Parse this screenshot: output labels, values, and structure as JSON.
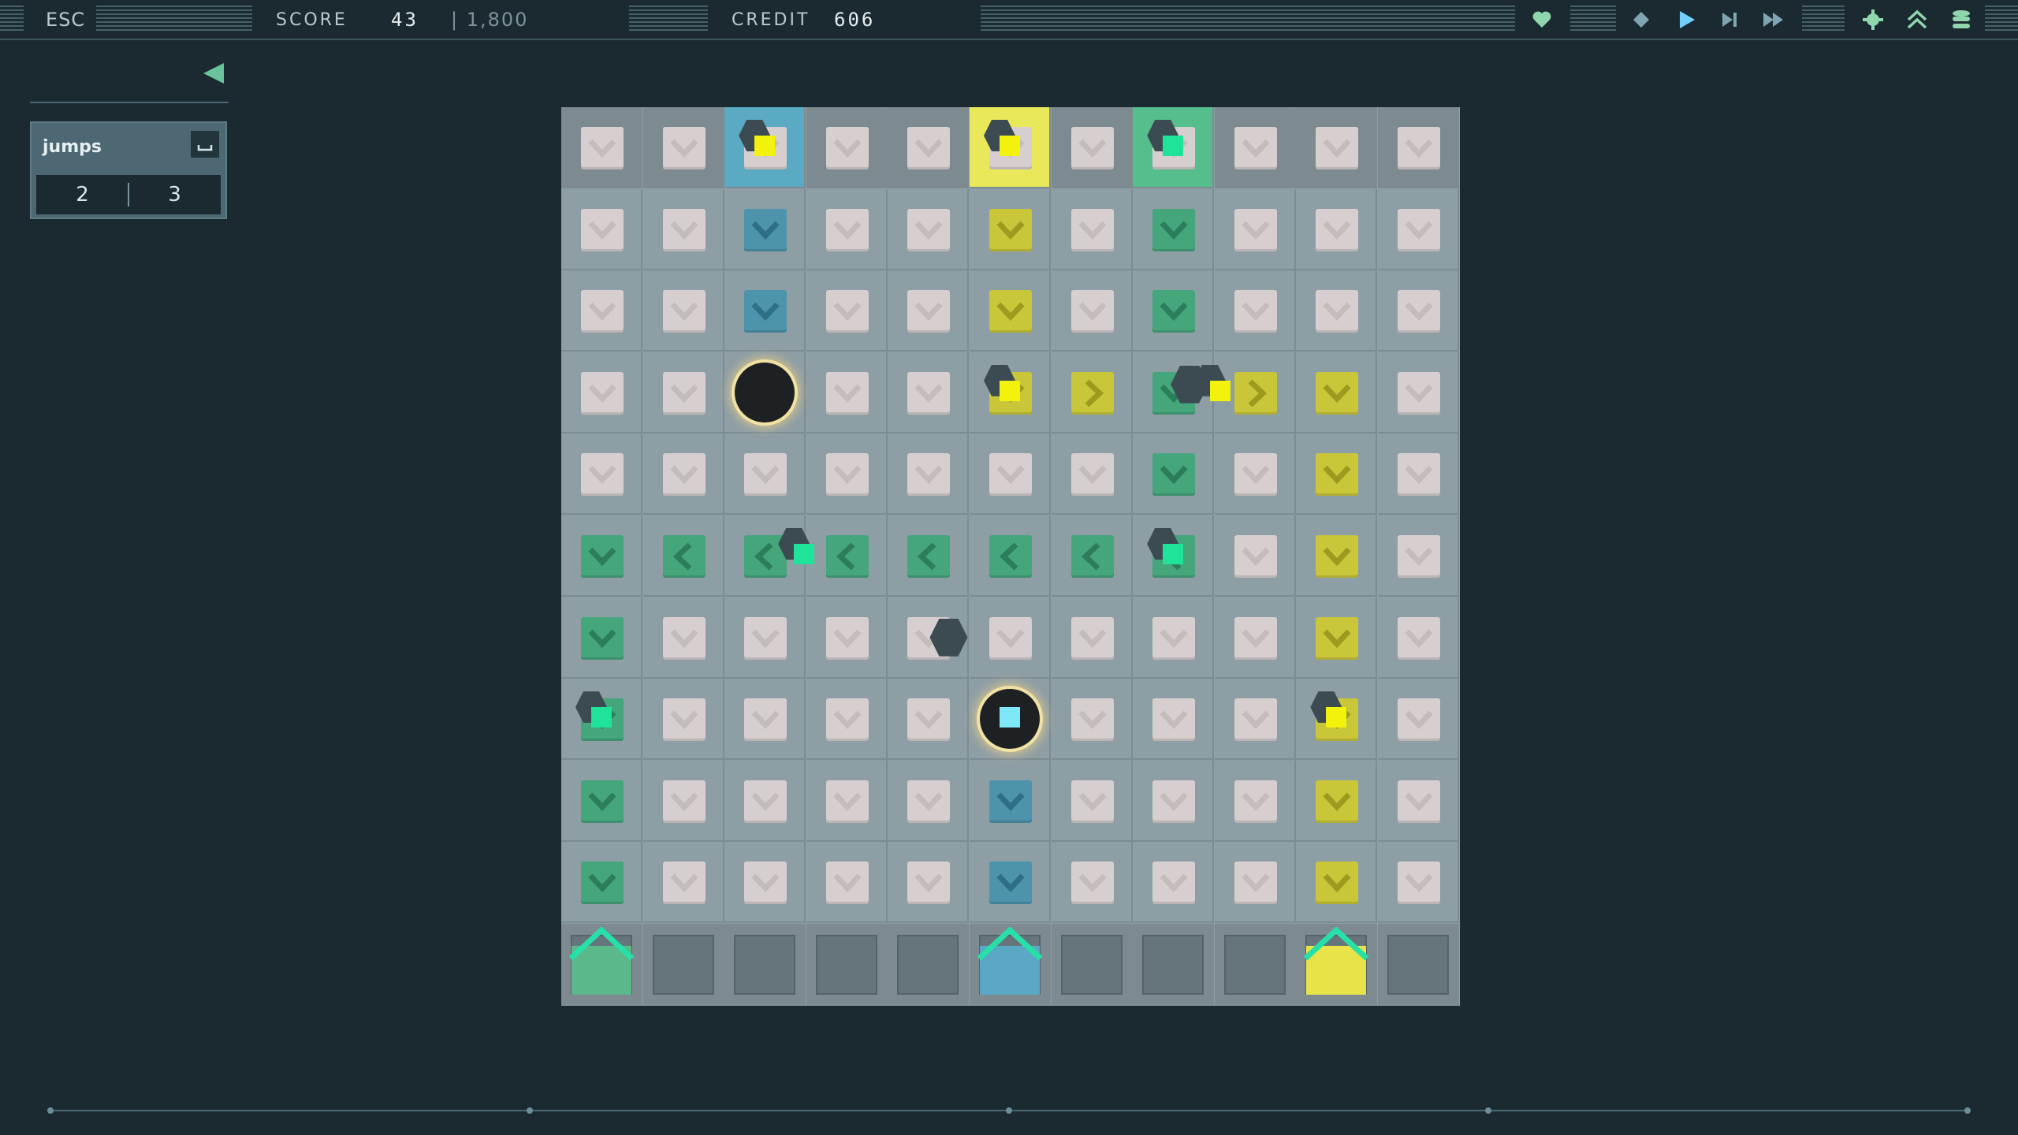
{
  "topbar": {
    "esc_label": "ESC",
    "score_label": "SCORE",
    "score_value": "43",
    "score_target": "| 1,800",
    "credit_label": "CREDIT",
    "credit_value": "606",
    "icons": [
      "heart-icon",
      "diamond-icon",
      "play-icon",
      "step-icon",
      "fast-forward-icon",
      "settings-sun-icon",
      "double-chevron-up-icon",
      "stack-icon"
    ]
  },
  "panel": {
    "title": "jumps",
    "key_icon": "spacebar-icon",
    "values": [
      "2",
      "3"
    ]
  },
  "board": {
    "cols": 11,
    "rows": 11,
    "colors": {
      "green": "#45a67c",
      "blue": "#4d93ab",
      "yellow": "#c9c63a",
      "neutral": "#d7cfcf",
      "gem_green": "#20e39a",
      "gem_yellow": "#f2f20c",
      "gem_cyan": "#7fe8f6"
    },
    "grid": [
      [
        "n:down",
        "n:down",
        "H:blue",
        "n:down",
        "n:down",
        "H:yellow",
        "n:down",
        "H:green",
        "n:down",
        "n:down",
        "n:down"
      ],
      [
        "n:down",
        "n:down",
        "b:down",
        "n:down",
        "n:down",
        "y:down",
        "n:down",
        "g:down",
        "n:down",
        "n:down",
        "n:down"
      ],
      [
        "n:down",
        "n:down",
        "b:down",
        "n:down",
        "n:down",
        "y:down",
        "n:down",
        "g:down",
        "n:down",
        "n:down",
        "n:down"
      ],
      [
        "n:down",
        "n:down",
        "hole",
        "n:down",
        "n:down",
        "y:down",
        "y:right",
        "g:down",
        "y:right",
        "y:down",
        "n:down"
      ],
      [
        "n:down",
        "n:down",
        "n:down",
        "n:down",
        "n:down",
        "n:down",
        "n:down",
        "g:down",
        "n:down",
        "y:down",
        "n:down"
      ],
      [
        "g:down",
        "g:left",
        "g:left",
        "g:left",
        "g:left",
        "g:left",
        "g:left",
        "g:left",
        "n:down",
        "y:down",
        "n:down"
      ],
      [
        "g:down",
        "n:down",
        "n:down",
        "n:down",
        "n:down",
        "n:down",
        "n:down",
        "n:down",
        "n:down",
        "y:down",
        "n:down"
      ],
      [
        "g:down",
        "n:down",
        "n:down",
        "n:down",
        "n:down",
        "hole",
        "n:down",
        "n:down",
        "n:down",
        "y:down",
        "n:down"
      ],
      [
        "g:down",
        "n:down",
        "n:down",
        "n:down",
        "n:down",
        "b:down",
        "n:down",
        "n:down",
        "n:down",
        "y:down",
        "n:down"
      ],
      [
        "g:down",
        "n:down",
        "n:down",
        "n:down",
        "n:down",
        "b:down",
        "n:down",
        "n:down",
        "n:down",
        "y:down",
        "n:down"
      ],
      [
        "exit:green",
        "slot",
        "slot",
        "slot",
        "slot",
        "exit:blue",
        "slot",
        "slot",
        "slot",
        "exit:yellow",
        "slot"
      ]
    ]
  },
  "timeline": {
    "ticks": 5
  }
}
